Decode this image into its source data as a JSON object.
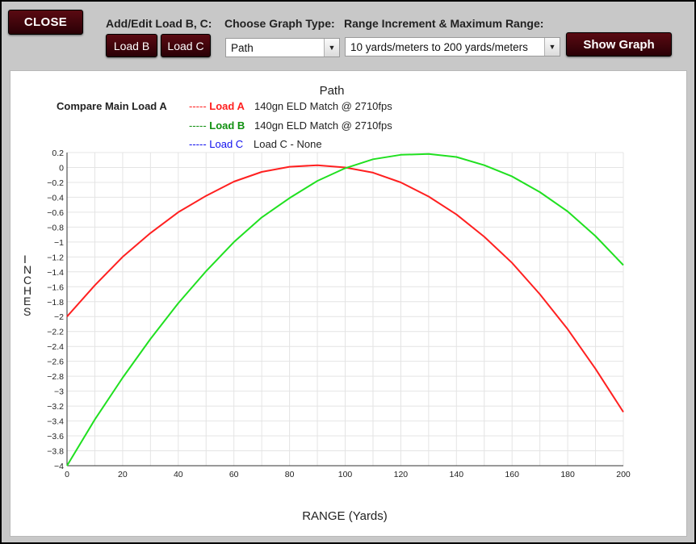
{
  "toolbar": {
    "close_label": "CLOSE",
    "add_edit_label": "Add/Edit Load B, C:",
    "load_b_label": "Load B",
    "load_c_label": "Load C",
    "graph_type_label": "Choose Graph Type:",
    "graph_type_value": "Path",
    "range_label": "Range Increment & Maximum Range:",
    "range_value": "10 yards/meters to 200 yards/meters",
    "show_graph_label": "Show Graph"
  },
  "colors": {
    "load_a": "#ff2020",
    "load_b": "#20e020",
    "load_c": "#1010ff",
    "load_b_label": "#109010",
    "load_a_label": "#ff2020",
    "load_c_label": "#1010ee"
  },
  "legend": {
    "compare_label": "Compare Main Load A",
    "a_dash": "----- ",
    "a_name": "Load A",
    "a_desc": "140gn ELD Match @ 2710fps",
    "b_dash": "----- ",
    "b_name": "Load B",
    "b_desc": "140gn ELD Match @ 2710fps",
    "c_dash": "----- ",
    "c_name": "Load C",
    "c_desc": "Load C - None"
  },
  "chart_data": {
    "type": "line",
    "title": "Path",
    "xlabel": "RANGE  (Yards)",
    "ylabel": "INCHES",
    "xlim": [
      0,
      200
    ],
    "ylim": [
      -4,
      0.2
    ],
    "x_ticks": [
      "0",
      "20",
      "40",
      "60",
      "80",
      "100",
      "120",
      "140",
      "160",
      "180",
      "200"
    ],
    "y_ticks": [
      "0.2",
      "0",
      "−0.2",
      "−0.4",
      "−0.6",
      "−0.8",
      "−1",
      "−1.2",
      "−1.4",
      "−1.6",
      "−1.8",
      "−2",
      "−2.2",
      "−2.4",
      "−2.6",
      "−2.8",
      "−3",
      "−3.2",
      "−3.4",
      "−3.6",
      "−3.8",
      "−4"
    ],
    "x": [
      0,
      10,
      20,
      30,
      40,
      50,
      60,
      70,
      80,
      90,
      100,
      110,
      120,
      130,
      140,
      150,
      160,
      170,
      180,
      190,
      200
    ],
    "grid": true,
    "series": [
      {
        "name": "Load A",
        "color": "#ff2020",
        "values": [
          -2.0,
          -1.58,
          -1.2,
          -0.88,
          -0.6,
          -0.38,
          -0.19,
          -0.06,
          0.01,
          0.03,
          0.0,
          -0.07,
          -0.2,
          -0.39,
          -0.63,
          -0.93,
          -1.28,
          -1.7,
          -2.17,
          -2.7,
          -3.28
        ]
      },
      {
        "name": "Load B",
        "color": "#20e020",
        "values": [
          -4.0,
          -3.38,
          -2.82,
          -2.3,
          -1.82,
          -1.39,
          -1.0,
          -0.67,
          -0.41,
          -0.18,
          -0.01,
          0.11,
          0.17,
          0.18,
          0.14,
          0.03,
          -0.12,
          -0.33,
          -0.59,
          -0.92,
          -1.31
        ]
      }
    ]
  }
}
